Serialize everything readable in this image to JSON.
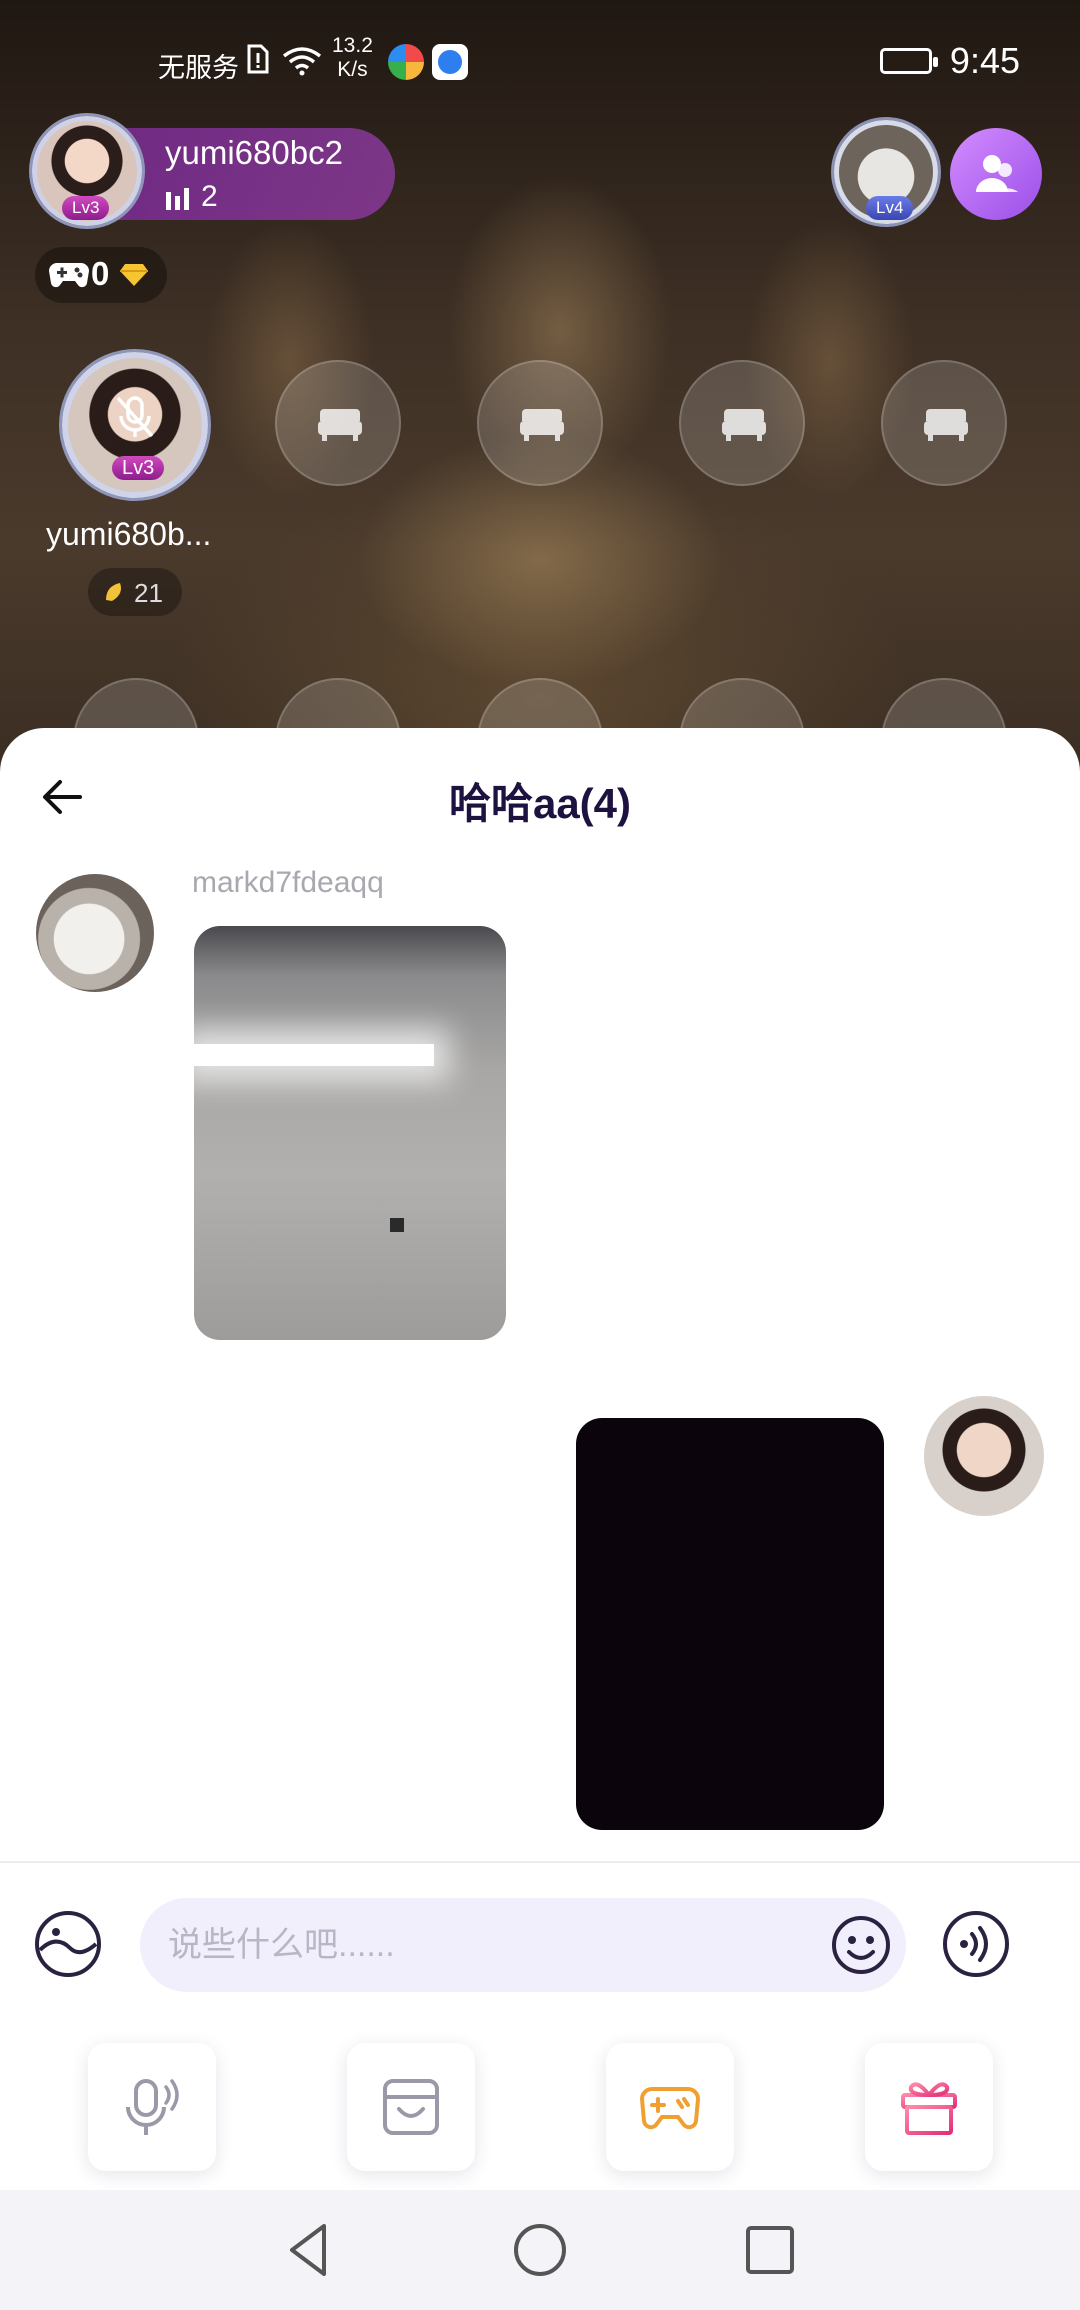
{
  "status_bar": {
    "carrier": "无服务",
    "speed_value": "13.2",
    "speed_unit": "K/s",
    "time": "9:45"
  },
  "host": {
    "name": "yumi680bc2",
    "level": "Lv3",
    "online_count": "2",
    "game_count": "0"
  },
  "right_user": {
    "level": "Lv4"
  },
  "mic_host": {
    "name": "yumi680b...",
    "level": "Lv3",
    "coins": "21"
  },
  "chat": {
    "title": "哈哈aa(4)",
    "messages": [
      {
        "sender": "markd7fdeaqq",
        "type": "image",
        "side": "left"
      },
      {
        "sender": "",
        "type": "image",
        "side": "right"
      }
    ]
  },
  "composer": {
    "placeholder": "说些什么吧......",
    "value": ""
  },
  "icons": {
    "sticker": "sticker-icon",
    "emoji": "emoji-icon",
    "voice": "voice-icon",
    "mic": "mic-icon",
    "image": "image-icon",
    "game": "game-icon",
    "gift": "gift-icon"
  },
  "colors": {
    "accent_purple": "#9b4fe8",
    "title": "#1d1240",
    "game_orange": "#f0a030",
    "gift_pink": "#f24a8c"
  }
}
